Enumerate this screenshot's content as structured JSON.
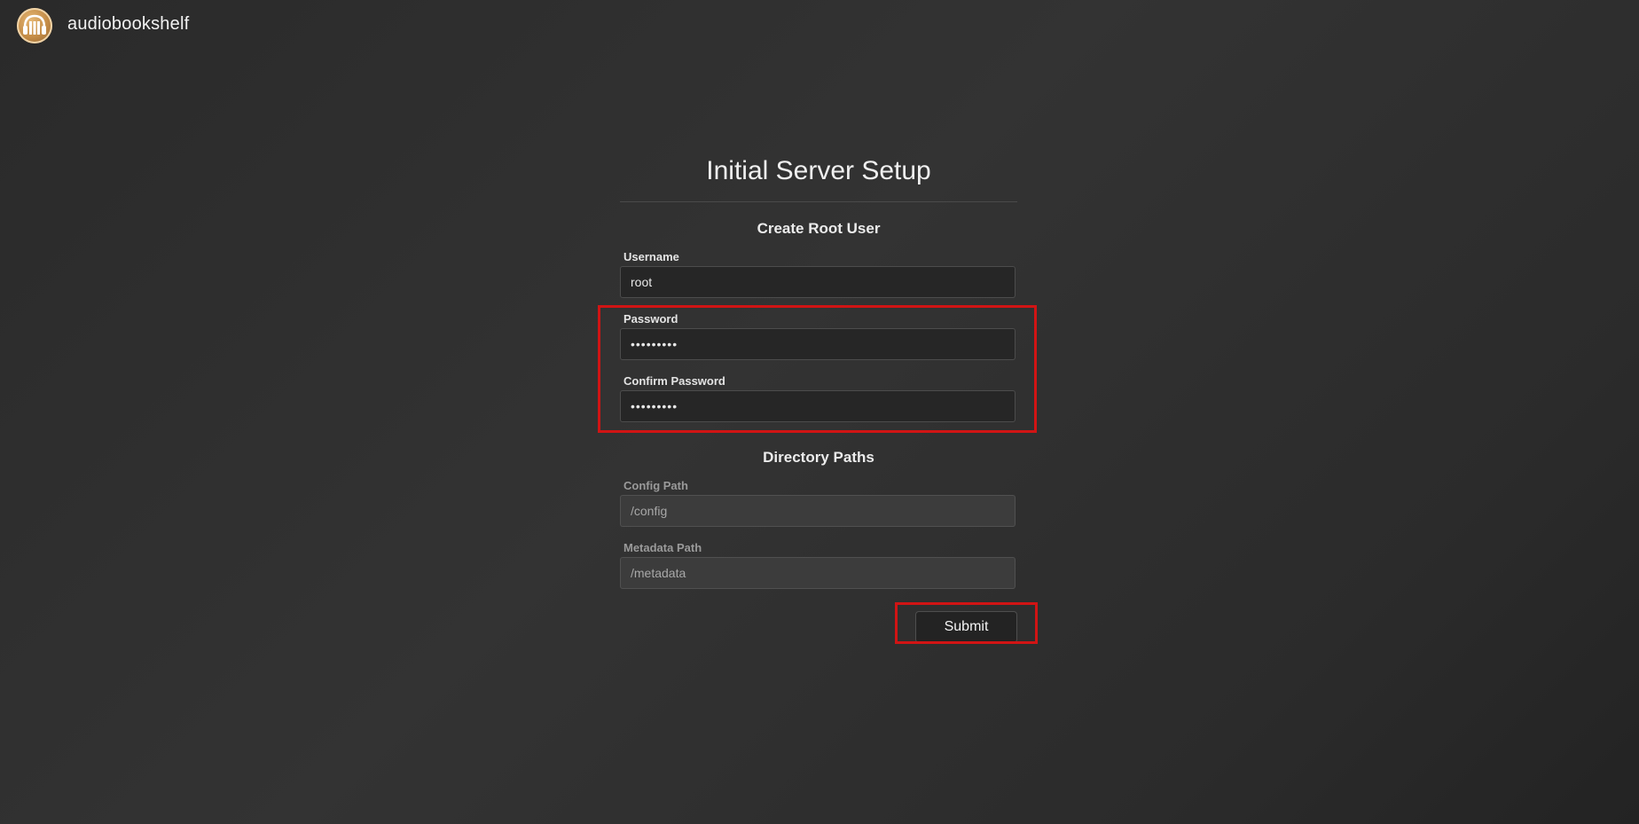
{
  "app": {
    "name": "audiobookshelf",
    "logo_icon": "headphones-books-icon"
  },
  "setup": {
    "title": "Initial Server Setup",
    "root_user": {
      "heading": "Create Root User",
      "username_label": "Username",
      "username_value": "root",
      "password_label": "Password",
      "password_value": "•••••••••",
      "confirm_label": "Confirm Password",
      "confirm_value": "•••••••••"
    },
    "paths": {
      "heading": "Directory Paths",
      "config_label": "Config Path",
      "config_value": "/config",
      "metadata_label": "Metadata Path",
      "metadata_value": "/metadata"
    },
    "submit_label": "Submit"
  },
  "colors": {
    "highlight": "#d11414",
    "logo": "#c28a45"
  }
}
